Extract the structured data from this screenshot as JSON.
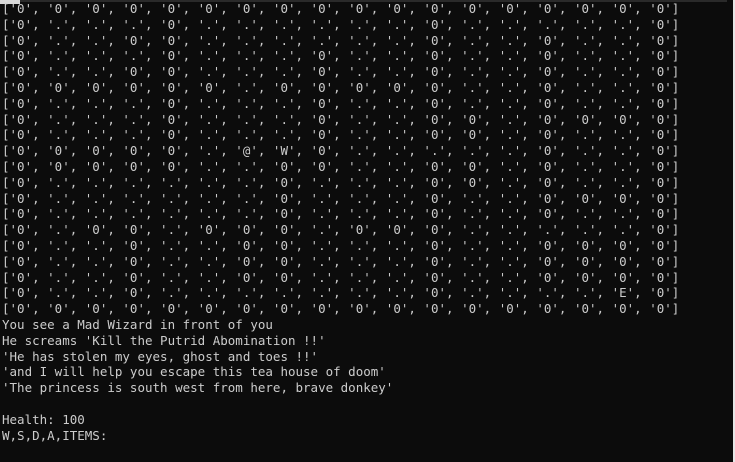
{
  "map_rows": [
    "['0', '0', '0', '0', '0', '0', '0', '0', '0', '0', '0', '0', '0', '0', '0', '0', '0', '0']",
    "['0', '.', '.', '.', '0', '.', '.', '.', '.', '.', '.', '0', '.', '.', '.', '.', '.', '0']",
    "['0', '.', '.', '0', '0', '.', '.', '.', '.', '.', '.', '0', '.', '.', '0', '.', '.', '0']",
    "['0', '.', '.', '.', '0', '.', '.', '.', '0', '.', '.', '0', '.', '.', '0', '.', '.', '0']",
    "['0', '.', '.', '0', '0', '.', '.', '.', '0', '.', '.', '0', '.', '.', '0', '.', '.', '0']",
    "['0', '0', '0', '0', '0', '0', '.', '0', '0', '0', '0', '0', '.', '.', '0', '.', '.', '0']",
    "['0', '.', '.', '.', '0', '.', '.', '.', '0', '.', '.', '0', '.', '.', '0', '.', '.', '0']",
    "['0', '.', '.', '.', '0', '.', '.', '.', '0', '.', '.', '0', '0', '.', '0', '0', '0', '0']",
    "['0', '.', '.', '.', '0', '.', '.', '.', '0', '.', '.', '0', '0', '.', '0', '.', '.', '0']",
    "['0', '0', '0', '0', '0', '.', '@', 'W', '0', '.', '.', '.', '.', '.', '0', '.', '.', '0']",
    "['0', '0', '0', '0', '0', '.', '.', '0', '0', '.', '.', '0', '0', '.', '0', '.', '.', '0']",
    "['0', '.', '.', '.', '.', '.', '.', '0', '.', '.', '.', '0', '0', '.', '0', '.', '.', '0']",
    "['0', '.', '.', '.', '.', '.', '.', '0', '.', '.', '.', '0', '.', '.', '0', '0', '0', '0']",
    "['0', '.', '.', '.', '.', '.', '.', '0', '.', '.', '.', '0', '.', '.', '0', '.', '.', '0']",
    "['0', '.', '0', '0', '.', '0', '0', '0', '.', '0', '0', '0', '.', '.', '.', '.', '.', '0']",
    "['0', '.', '.', '0', '.', '.', '0', '0', '.', '.', '.', '0', '.', '.', '0', '0', '0', '0']",
    "['0', '.', '.', '0', '.', '.', '0', '0', '.', '.', '.', '0', '.', '.', '0', '0', '0', '0']",
    "['0', '.', '.', '0', '.', '.', '0', '0', '.', '.', '.', '0', '.', '.', '0', '0', '0', '0']",
    "['0', '.', '.', '0', '.', '.', '.', '.', '.', '.', '.', '0', '.', '.', '.', '.', 'E', '0']",
    "['0', '0', '0', '0', '0', '0', '0', '0', '0', '0', '0', '0', '0', '0', '0', '0', '0', '0']"
  ],
  "messages": [
    "You see a Mad Wizard in front of you",
    "He screams 'Kill the Putrid Abomination !!'",
    "'He has stolen my eyes, ghost and toes !!'",
    "'and I will help you escape this tea house of doom'",
    "'The princess is south west from here, brave donkey'"
  ],
  "status": {
    "health": "Health: 100",
    "prompt": "W,S,D,A,ITEMS:"
  },
  "colors": {
    "background": "#0c0c0c",
    "text": "#cccccc"
  }
}
